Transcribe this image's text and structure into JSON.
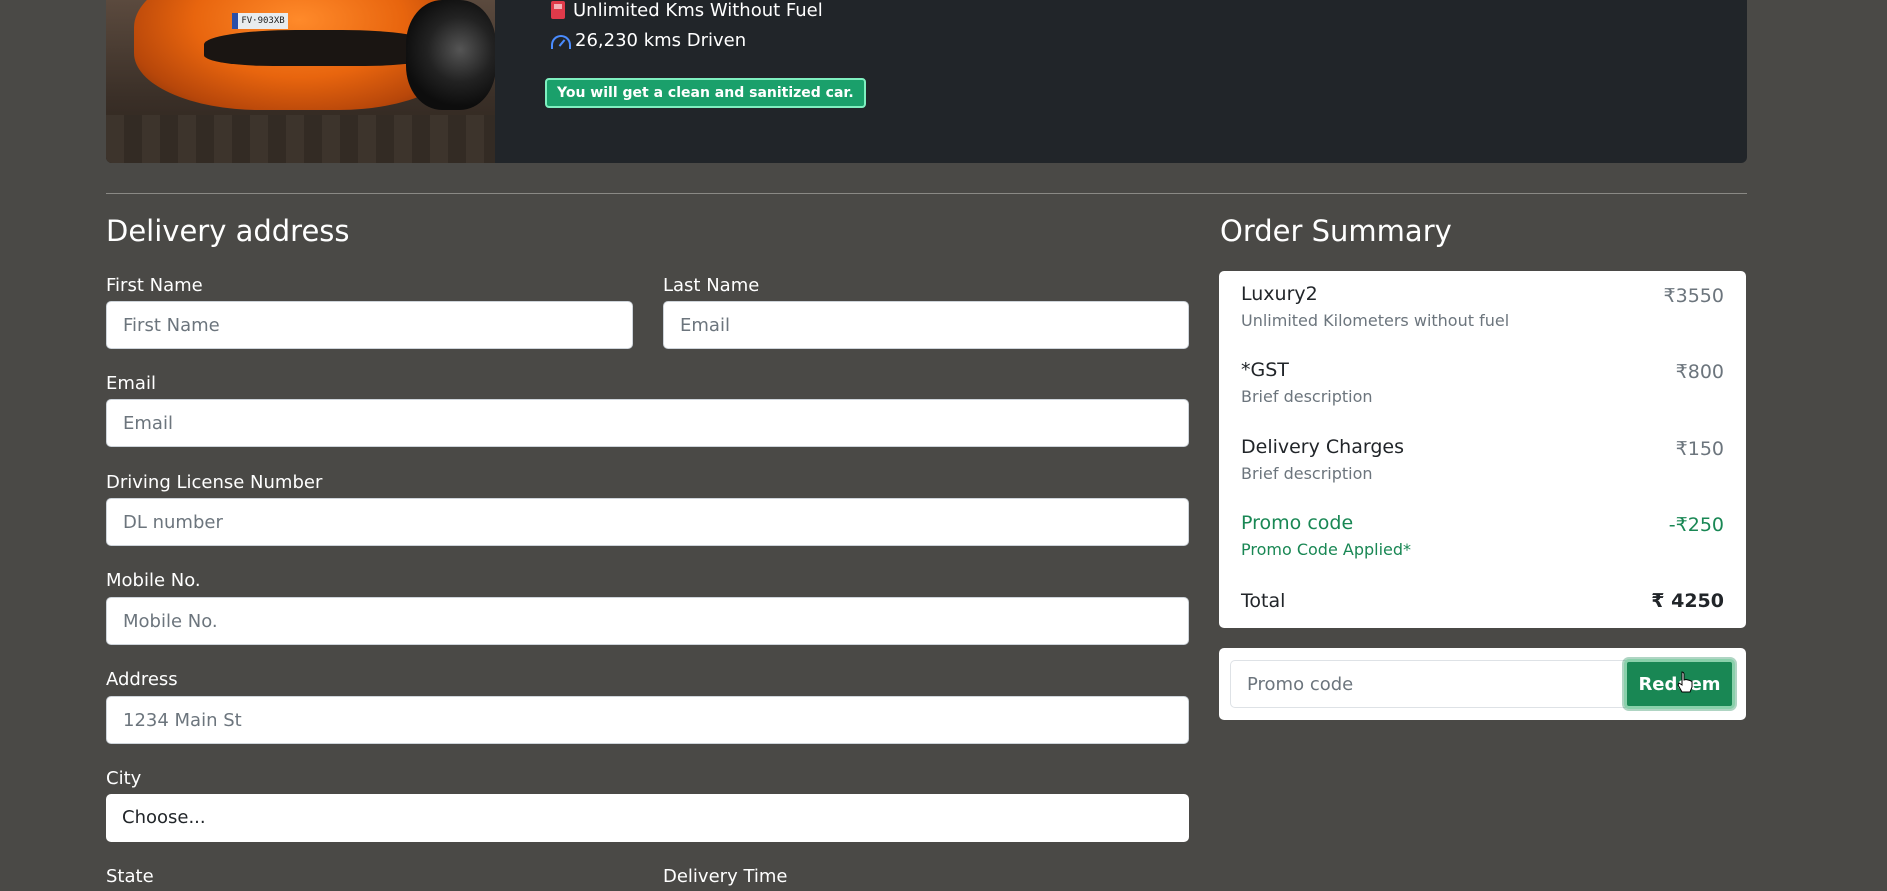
{
  "car": {
    "plate": "FV·903XB",
    "features": [
      {
        "icon": "fuel-icon",
        "text": "Unlimited Kms Without Fuel"
      },
      {
        "icon": "speedometer-icon",
        "text": "26,230 kms Driven"
      }
    ],
    "badge": "You will get a clean and sanitized car."
  },
  "delivery": {
    "title": "Delivery address",
    "first_name": {
      "label": "First Name",
      "placeholder": "First Name"
    },
    "last_name": {
      "label": "Last Name",
      "placeholder": "Email"
    },
    "email": {
      "label": "Email",
      "placeholder": "Email"
    },
    "license": {
      "label": "Driving License Number",
      "placeholder": "DL number"
    },
    "mobile": {
      "label": "Mobile No.",
      "placeholder": "Mobile No."
    },
    "address": {
      "label": "Address",
      "placeholder": "1234 Main St"
    },
    "city": {
      "label": "City",
      "value": "Choose..."
    },
    "state": {
      "label": "State"
    },
    "delivery_time": {
      "label": "Delivery Time"
    }
  },
  "summary": {
    "title": "Order Summary",
    "items": [
      {
        "title": "Luxury2",
        "desc": "Unlimited Kilometers without fuel",
        "price": "₹3550"
      },
      {
        "title": "*GST",
        "desc": "Brief description",
        "price": "₹800"
      },
      {
        "title": "Delivery Charges",
        "desc": "Brief description",
        "price": "₹150"
      },
      {
        "title": "Promo code",
        "desc": "Promo Code Applied*",
        "price": "-₹250"
      }
    ],
    "total_label": "Total",
    "total_price": "₹ 4250",
    "promo_placeholder": "Promo code",
    "redeem_label": "Redeem"
  },
  "colors": {
    "background": "#4a4946",
    "card": "#212529",
    "success": "#198754",
    "badge": "#1aa06b"
  }
}
